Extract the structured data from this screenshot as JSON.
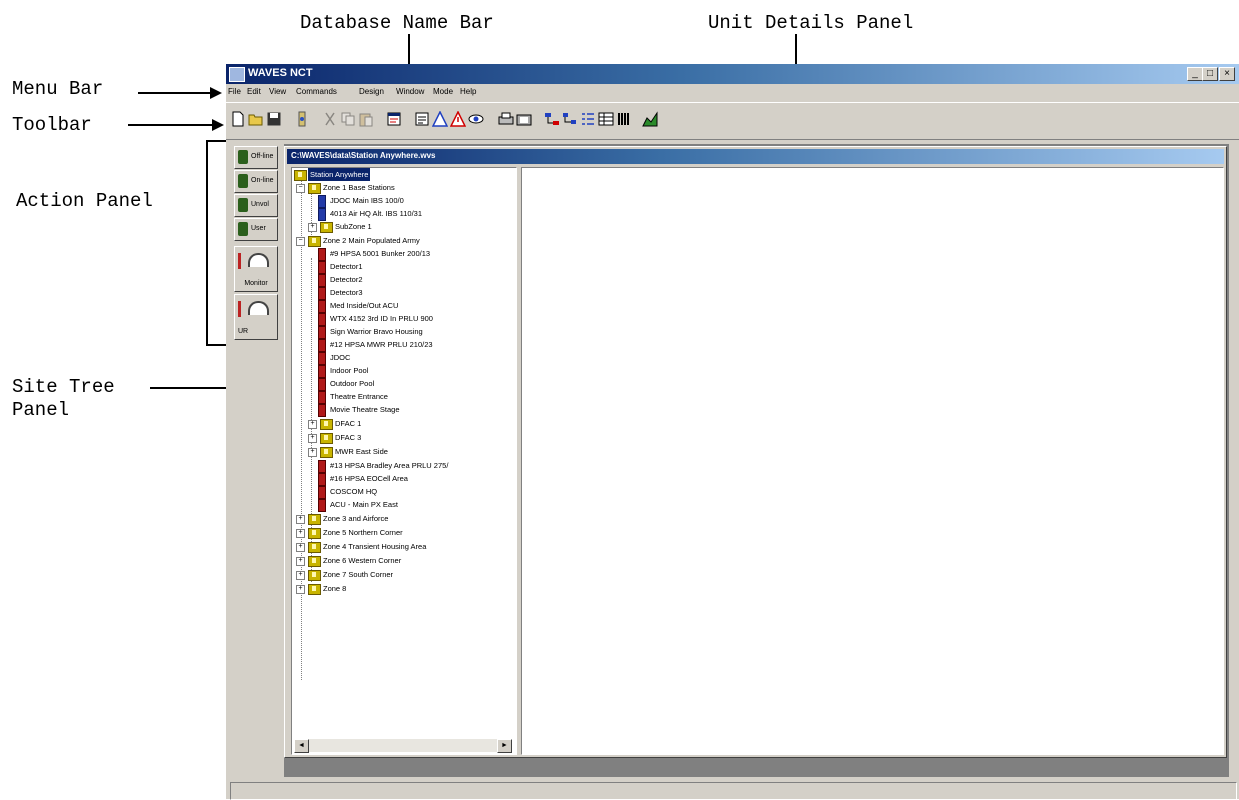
{
  "annotations": {
    "database_name_bar": "Database Name Bar",
    "unit_details_panel": "Unit Details Panel",
    "menu_bar": "Menu Bar",
    "toolbar": "Toolbar",
    "action_panel": "Action Panel",
    "site_tree_line1": "Site Tree",
    "site_tree_line2": "Panel"
  },
  "window": {
    "title": "WAVES NCT",
    "minimize": "_",
    "maximize": "□",
    "close": "×"
  },
  "menu": [
    "File",
    "Edit",
    "View",
    "Commands",
    "Design",
    "Window",
    "Mode",
    "Help"
  ],
  "toolbar_icons": [
    "new-icon",
    "open-icon",
    "save-icon",
    "connect-icon",
    "cut-icon",
    "copy-icon",
    "paste-icon",
    "properties-icon",
    "message-icon",
    "warning-icon",
    "alert-icon",
    "eye-icon",
    "print-icon",
    "camera-icon",
    "network-icon",
    "tree-icon",
    "list-icon",
    "details-icon",
    "bars-icon",
    "chart-icon"
  ],
  "action_panel": {
    "offline": "Off-line",
    "online": "On-line",
    "unvol": "Unvol",
    "user": "User",
    "monitor": "Monitor",
    "ui": "UR"
  },
  "database_path": "C:\\WAVES\\data\\Station Anywhere.wvs",
  "tree": {
    "root": "Station Anywhere",
    "zone1": "Zone 1 Base Stations",
    "zone1_items": [
      "JDOC Main IBS 100/0",
      "4013 Air HQ Alt. IBS 110/31"
    ],
    "zone1_sub": "SubZone 1",
    "zone2": "Zone 2 Main Populated Army",
    "zone2_items": [
      "#9 HPSA 5001 Bunker 200/13",
      "Detector1",
      "Detector2",
      "Detector3",
      "Med Inside/Out ACU",
      "WTX 4152 3rd ID In PRLU 900",
      "Sign Warrior Bravo Housing",
      "#12 HPSA MWR PRLU 210/23",
      "JDOC",
      "Indoor Pool",
      "Outdoor Pool",
      "Theatre Entrance",
      "Movie Theatre Stage"
    ],
    "zone2_folders": [
      "DFAC 1",
      "DFAC 3",
      "MWR East Side"
    ],
    "zone2_items_after": [
      "#13 HPSA Bradley Area PRLU 275/",
      "#16 HPSA EOCell Area",
      "COSCOM HQ",
      "ACU - Main PX East"
    ],
    "zones_collapsed": [
      "Zone 3 and Airforce",
      "Zone 5 Northern Corner",
      "Zone 4 Transient Housing Area",
      "Zone 6 Western Corner",
      "Zone 7 South Corner",
      "Zone 8"
    ]
  },
  "scroll": {
    "left": "◄",
    "right": "►"
  }
}
